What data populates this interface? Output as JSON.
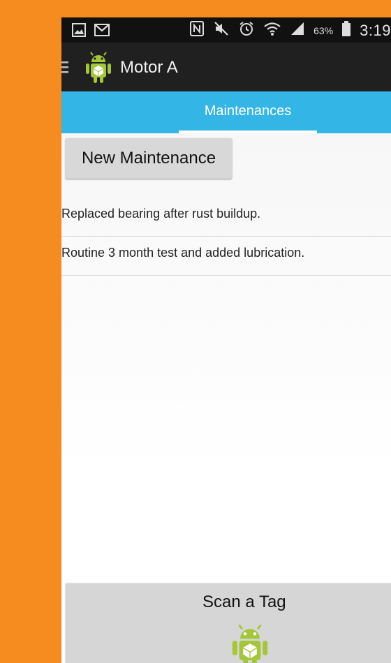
{
  "status_bar": {
    "icons": [
      "gallery-icon",
      "gmail-icon",
      "nfc-icon",
      "mute-icon",
      "alarm-icon",
      "wifi-icon",
      "signal-icon",
      "battery-icon"
    ],
    "battery_percent": "63%",
    "time": "3:19"
  },
  "action_bar": {
    "title": "Motor A",
    "icons": [
      "menu-icon",
      "android-app-icon"
    ]
  },
  "tabs": [
    {
      "label": "Maintenances",
      "selected": true
    }
  ],
  "buttons": {
    "new_maintenance": "New Maintenance",
    "scan_tag": "Scan a Tag"
  },
  "maintenances": [
    {
      "text": "Replaced bearing after rust buildup."
    },
    {
      "text": "Routine 3 month test and added lubrication."
    }
  ],
  "colors": {
    "background": "#f68b1f",
    "status_bar": "#111111",
    "action_bar": "#202020",
    "tab_bar": "#33b5e5",
    "android_green": "#a4c639"
  }
}
